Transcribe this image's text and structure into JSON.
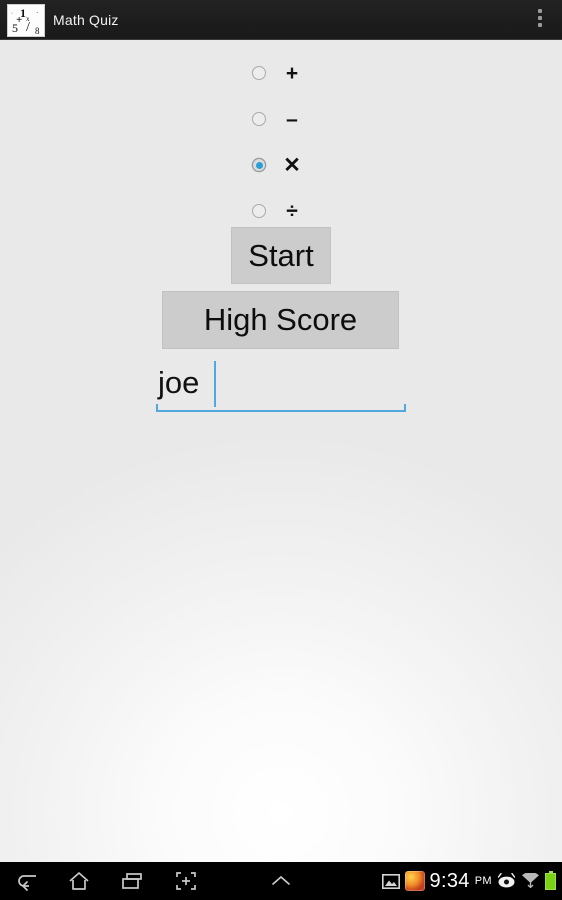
{
  "action_bar": {
    "title": "Math Quiz",
    "app_icon_name": "math-quiz-app-icon",
    "icon_glyphs": {
      "dot1": "·",
      "one": "1",
      "dash": "·",
      "plus": "+",
      "x": "x",
      "five": "5",
      "slash": "/",
      "eight": "8"
    },
    "overflow_label": "More options"
  },
  "operations": {
    "selected_index": 2,
    "items": [
      {
        "id": "add",
        "symbol": "+",
        "selected": false
      },
      {
        "id": "subtract",
        "symbol": "–",
        "selected": false
      },
      {
        "id": "multiply",
        "symbol": "✕",
        "selected": true
      },
      {
        "id": "divide",
        "symbol": "÷",
        "selected": false
      }
    ]
  },
  "buttons": {
    "start": "Start",
    "high_score": "High Score"
  },
  "name_input": {
    "value": "joe",
    "placeholder": "",
    "caret_visible": true,
    "accent_color": "#50a8dd"
  },
  "system_bar": {
    "nav": [
      {
        "id": "back",
        "label": "Back"
      },
      {
        "id": "home",
        "label": "Home"
      },
      {
        "id": "recent",
        "label": "Recent apps"
      },
      {
        "id": "screenshot",
        "label": "Screenshot"
      },
      {
        "id": "expand-up",
        "label": "Expand"
      }
    ],
    "status": {
      "clock": "9:34",
      "ampm": "PM",
      "icons": [
        {
          "id": "screenshot-notification",
          "name": "image-icon"
        },
        {
          "id": "app-notification",
          "name": "colorful-app-icon"
        },
        {
          "id": "eye",
          "name": "eye-icon"
        },
        {
          "id": "wifi",
          "name": "wifi-icon"
        },
        {
          "id": "battery",
          "name": "battery-icon"
        }
      ]
    }
  },
  "colors": {
    "accent_blue": "#2a9fd6",
    "input_underline": "#50a8dd",
    "button_bg": "#cccccc",
    "action_bar_bg": "#1d1d1d",
    "battery_green": "#7bd116"
  }
}
